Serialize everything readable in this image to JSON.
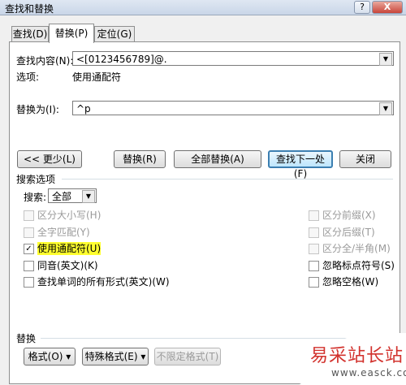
{
  "window": {
    "title": "查找和替换",
    "help_label": "?",
    "close_label": "X"
  },
  "tabs": [
    {
      "label": "查找(D)"
    },
    {
      "label": "替换(P)"
    },
    {
      "label": "定位(G)"
    }
  ],
  "find": {
    "label": "查找内容(N):",
    "value": "<[0123456789]@."
  },
  "options": {
    "label": "选项:",
    "value": "使用通配符"
  },
  "replace": {
    "label": "替换为(I):",
    "value": "^p"
  },
  "buttons": {
    "less": "<< 更少(L)",
    "replace": "替换(R)",
    "replace_all": "全部替换(A)",
    "find_next": "查找下一处(F)",
    "close": "关闭"
  },
  "search_options": {
    "section_label": "搜索选项",
    "direction_label": "搜索:",
    "direction_value": "全部",
    "left": [
      {
        "label": "区分大小写(H)",
        "checked": false,
        "disabled": true
      },
      {
        "label": "全字匹配(Y)",
        "checked": false,
        "disabled": true
      },
      {
        "label": "使用通配符(U)",
        "checked": true,
        "disabled": false
      },
      {
        "label": "同音(英文)(K)",
        "checked": false,
        "disabled": false
      },
      {
        "label": "查找单词的所有形式(英文)(W)",
        "checked": false,
        "disabled": false
      }
    ],
    "right": [
      {
        "label": "区分前缀(X)",
        "checked": false,
        "disabled": true
      },
      {
        "label": "区分后缀(T)",
        "checked": false,
        "disabled": true
      },
      {
        "label": "区分全/半角(M)",
        "checked": false,
        "disabled": true
      },
      {
        "label": "忽略标点符号(S)",
        "checked": false,
        "disabled": false
      },
      {
        "label": "忽略空格(W)",
        "checked": false,
        "disabled": false
      }
    ]
  },
  "replace_section": {
    "label": "替换",
    "format": "格式(O) ▾",
    "special": "特殊格式(E) ▾",
    "no_format": "不限定格式(T)"
  },
  "watermark": {
    "text": "易采站长站",
    "url": "www.easck.com"
  }
}
